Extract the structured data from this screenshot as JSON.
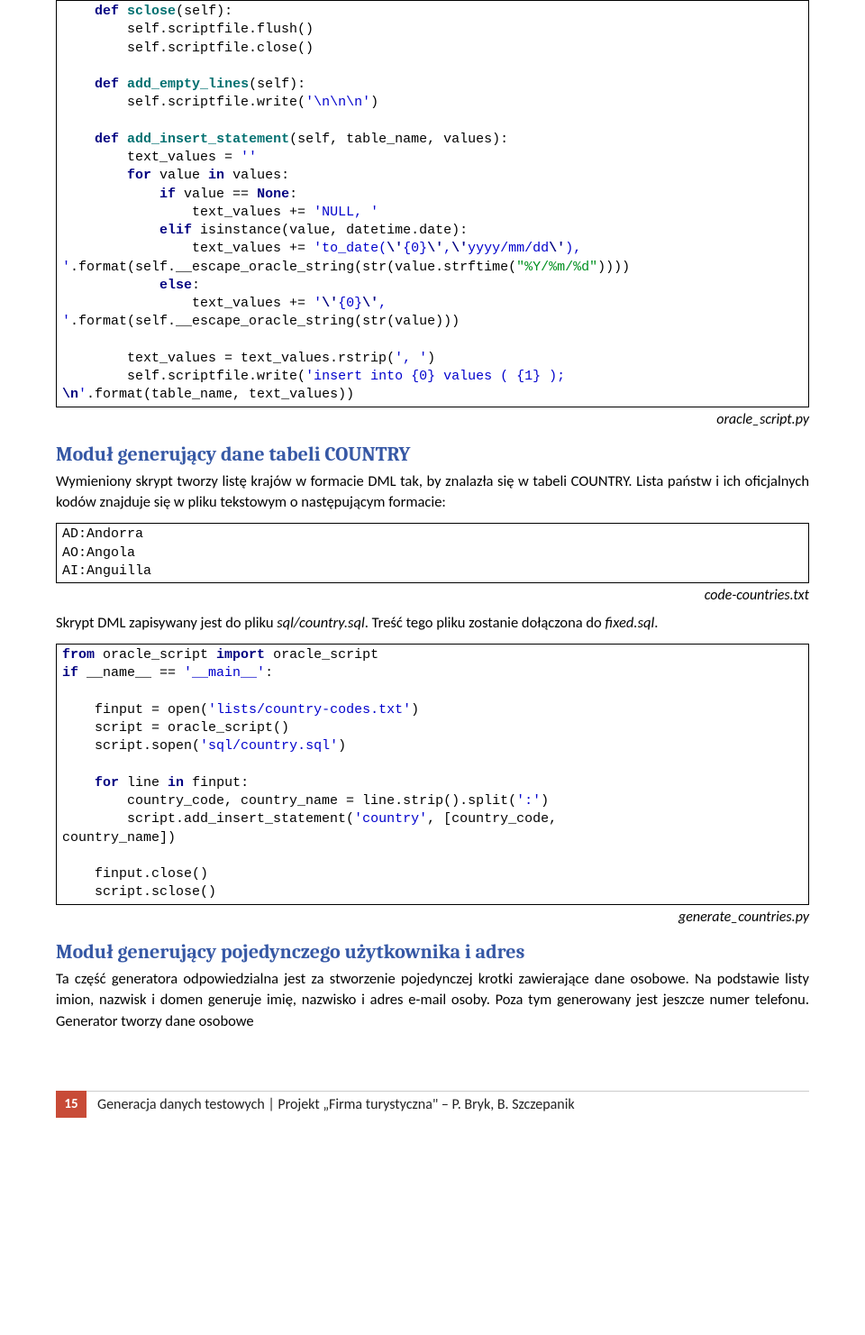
{
  "code1": {
    "l1a": "    def",
    "l1b": "sclose",
    "l1c": "(self):",
    "l2": "        self.scriptfile.flush()",
    "l3": "        self.scriptfile.close()",
    "l4a": "    def",
    "l4b": "add_empty_lines",
    "l4c": "(self):",
    "l5a": "        self.scriptfile.write(",
    "l5b": "'\\n\\n\\n'",
    "l5c": ")",
    "l6a": "    def",
    "l6b": "add_insert_statement",
    "l6c": "(self, table_name, values):",
    "l7a": "        text_values = ",
    "l7b": "''",
    "l8a": "        for",
    "l8b": " value ",
    "l8c": "in",
    "l8d": " values:",
    "l9a": "            if",
    "l9b": " value == ",
    "l9c": "None",
    "l9d": ":",
    "l10a": "                text_values += ",
    "l10b": "'NULL, '",
    "l11a": "            elif",
    "l11b": " isinstance(value, datetime.date):",
    "l12a": "                text_values += ",
    "l12b": "'to_date(",
    "l12c": "\\'",
    "l12d": "{0}",
    "l12e": "\\'",
    "l12f": ",",
    "l12g": "\\'",
    "l12h": "yyyy/mm/dd",
    "l12i": "\\'",
    "l12j": "), ",
    "l12k": "'",
    "l12l": ".format(self.__escape_oracle_string(str(value.strftime(",
    "l12m": "\"%Y/%m/%d\"",
    "l12n": "))))",
    "l13a": "            else",
    "l13b": ":",
    "l14a": "                text_values += ",
    "l14b": "'",
    "l14c": "\\'",
    "l14d": "{0}",
    "l14e": "\\'",
    "l14f": ", ",
    "l14g": "'",
    "l14h": ".format(self.__escape_oracle_string(str(value)))",
    "l15a": "        text_values = text_values.rstrip(",
    "l15b": "', '",
    "l15c": ")",
    "l16a": "        self.scriptfile.write(",
    "l16b": "'insert into {0} values ( {1} ); ",
    "l16c": "\\n",
    "l16d": "'",
    "l16e": ".format(table_name, text_values))"
  },
  "caption1": "oracle_script.py",
  "heading1": "Moduł generujący dane tabeli COUNTRY",
  "para1": "Wymieniony skrypt tworzy listę krajów w formacie DML tak, by znalazła się w tabeli COUNTRY. Lista państw i ich oficjalnych kodów znajduje się w pliku tekstowym o następującym formacie:",
  "code2": {
    "l1": "AD:Andorra",
    "l2": "AO:Angola",
    "l3": "AI:Anguilla"
  },
  "caption2": "code-countries.txt",
  "para2a": "Skrypt DML zapisywany jest do pliku ",
  "para2b": "sql/country.sql",
  "para2c": ". Treść tego pliku zostanie dołączona do ",
  "para2d": "fixed.sql",
  "para2e": ".",
  "code3": {
    "l1a": "from",
    "l1b": " oracle_script ",
    "l1c": "import",
    "l1d": " oracle_script",
    "l2a": "if",
    "l2b": " __name__ == ",
    "l2c": "'__main__'",
    "l2d": ":",
    "l3a": "    finput = open(",
    "l3b": "'lists/country-codes.txt'",
    "l3c": ")",
    "l4": "    script = oracle_script()",
    "l5a": "    script.sopen(",
    "l5b": "'sql/country.sql'",
    "l5c": ")",
    "l6a": "    for",
    "l6b": " line ",
    "l6c": "in",
    "l6d": " finput:",
    "l7a": "        country_code, country_name = line.strip().split(",
    "l7b": "':'",
    "l7c": ")",
    "l8a": "        script.add_insert_statement(",
    "l8b": "'country'",
    "l8c": ", [country_code, ",
    "l9": "country_name])",
    "l10": "    finput.close()",
    "l11": "    script.sclose()"
  },
  "caption3": "generate_countries.py",
  "heading2": "Moduł generujący pojedynczego użytkownika i adres",
  "para3": "Ta część generatora odpowiedzialna jest za stworzenie pojedynczej krotki zawierające dane osobowe. Na podstawie listy imion, nazwisk i domen generuje imię, nazwisko i adres e-mail osoby. Poza tym generowany jest jeszcze numer telefonu. Generator tworzy dane osobowe",
  "footer": {
    "page": "15",
    "text": "Generacja danych testowych | Projekt „Firma turystyczna\" – P. Bryk, B. Szczepanik"
  }
}
